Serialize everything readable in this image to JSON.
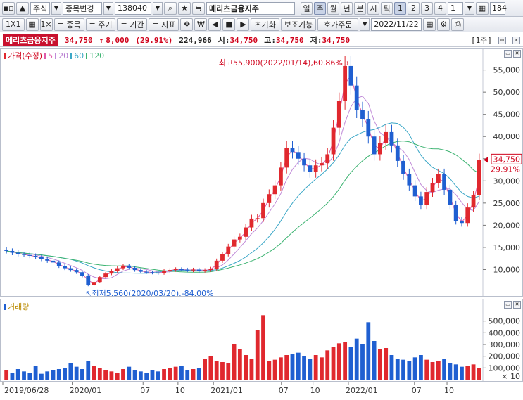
{
  "toolbar1": {
    "market": "주식",
    "stock_change": "종목변경",
    "code": "138040",
    "name": "메리츠금융지주",
    "periods": [
      "일",
      "주",
      "월",
      "년",
      "분",
      "시",
      "틱"
    ],
    "active_period": "주",
    "numbers": [
      "1",
      "2",
      "3",
      "4"
    ],
    "combo_value": "1",
    "count_value": "184"
  },
  "toolbar2": {
    "layout": "1X1",
    "item_btn": "종목",
    "cycle_btn": "주기",
    "term_btn": "기간",
    "indicator_btn": "지표",
    "reset": "초기화",
    "aux": "보조기능",
    "order": "호가주문",
    "date": "2022/11/22"
  },
  "info": {
    "name": "메리츠금융지주",
    "price": "34,750",
    "change": "8,000",
    "change_pct": "(29.91%)",
    "volume": "224,966",
    "open_label": "시",
    "open": "34,750",
    "high_label": "고",
    "high": "34,750",
    "low_label": "저",
    "low": "34,750",
    "period_badge": "[1주]"
  },
  "price_panel": {
    "legend_price": "가격(수정)",
    "ma": [
      {
        "label": "5",
        "color": "#d94ea3"
      },
      {
        "label": "20",
        "color": "#d94ea3"
      },
      {
        "label": "60",
        "color": "#2a9ad6"
      },
      {
        "label": "120",
        "color": "#2a9ad6"
      }
    ],
    "high_annotation": "최고55,900(2022/01/14),60.86%",
    "low_annotation": "최저5,560(2020/03/20),-84.00%",
    "last_price_tag": "34,750",
    "last_pct_tag": "29.91%",
    "y_ticks": [
      "55,000",
      "50,000",
      "45,000",
      "40,000",
      "35,000",
      "30,000",
      "25,000",
      "20,000",
      "15,000",
      "10,000"
    ]
  },
  "volume_panel": {
    "legend": "거래량",
    "y_ticks": [
      "500,000",
      "400,000",
      "300,000",
      "200,000",
      "100,000"
    ],
    "unit": "× 10"
  },
  "x_axis": {
    "labels": [
      "2019/06/28",
      "2020/01",
      "07",
      "10",
      "2021/01",
      "07",
      "10",
      "2022/01",
      "07",
      "10"
    ]
  },
  "colors": {
    "up": "#e0282e",
    "down": "#1f5fd1",
    "ma5": "#e05aa8",
    "ma20": "#c08ad8",
    "ma60": "#3ba7c7",
    "ma120": "#3cb371"
  },
  "chart_data": {
    "type": "candlestick",
    "series": [
      {
        "name": "가격(수정)",
        "close": [
          14200,
          13800,
          13500,
          13300,
          13100,
          12800,
          12400,
          12000,
          11600,
          10800,
          10300,
          9900,
          9400,
          8600,
          6500,
          7200,
          8300,
          9100,
          9700,
          10300,
          10900,
          10400,
          9900,
          9500,
          9400,
          9300,
          9200,
          9700,
          9900,
          10100,
          10000,
          9800,
          10000,
          9700,
          9900,
          10200,
          12000,
          13500,
          15200,
          16800,
          17400,
          19500,
          21500,
          21600,
          25000,
          27000,
          29000,
          33000,
          37500,
          36500,
          35000,
          33500,
          32000,
          33500,
          34000,
          36000,
          42000,
          48000,
          55900,
          51500,
          46000,
          44000,
          40000,
          36000,
          38500,
          41000,
          38000,
          34500,
          31500,
          29000,
          26500,
          24500,
          27500,
          29500,
          31500,
          28000,
          24500,
          21000,
          20500,
          24000,
          26750,
          34750
        ]
      },
      {
        "name": "거래량",
        "values": [
          80,
          60,
          90,
          70,
          60,
          120,
          50,
          70,
          80,
          90,
          100,
          140,
          110,
          90,
          160,
          120,
          100,
          80,
          70,
          60,
          90,
          110,
          80,
          70,
          60,
          80,
          70,
          90,
          100,
          110,
          120,
          80,
          90,
          100,
          180,
          200,
          160,
          150,
          140,
          300,
          260,
          210,
          180,
          420,
          550,
          160,
          170,
          190,
          210,
          220,
          230,
          200,
          180,
          210,
          190,
          250,
          280,
          310,
          320,
          280,
          350,
          300,
          490,
          330,
          260,
          270,
          210,
          180,
          170,
          160,
          190,
          210,
          170,
          150,
          160,
          180,
          140,
          130,
          110,
          120,
          130,
          100
        ]
      }
    ],
    "ylim": [
      5000,
      57000
    ],
    "vol_ylim": [
      0,
      600000
    ],
    "high": {
      "value": 55900,
      "date": "2022/01/14"
    },
    "low": {
      "value": 5560,
      "date": "2020/03/20"
    }
  }
}
